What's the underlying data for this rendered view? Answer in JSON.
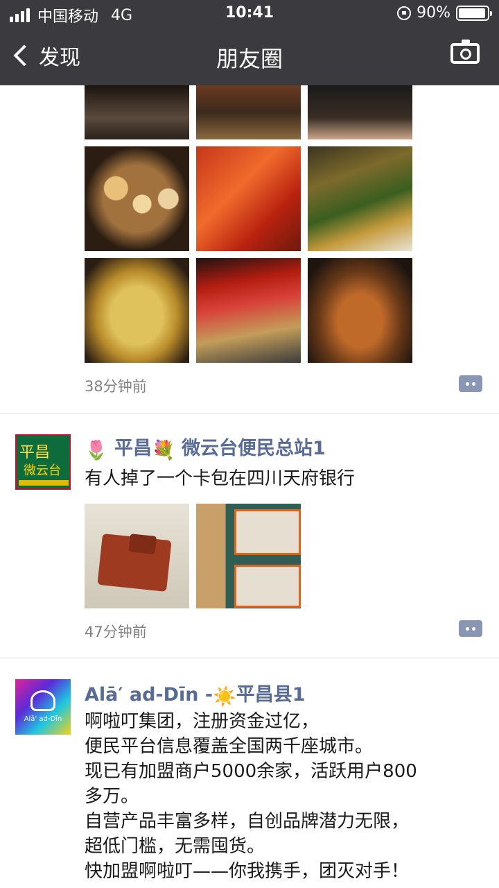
{
  "status_bar": {
    "carrier": "中国移动",
    "network": "4G",
    "time": "10:41",
    "battery": "90%"
  },
  "nav": {
    "back_label": "发现",
    "title": "朋友圈",
    "right_icon": "camera-icon"
  },
  "posts": [
    {
      "images": [
        "restaurant-interior",
        "restaurant-tables",
        "restaurant-floor",
        "seafood-platter",
        "crayfish",
        "grilled-fish-herbs",
        "baked-rice",
        "chili-fish",
        "spicy-dish"
      ],
      "time": "38分钟前"
    },
    {
      "avatar_text": [
        "平昌",
        "微云台"
      ],
      "name_prefix": "平昌",
      "name_suffix": "微云台便民总站1",
      "text": "有人掉了一个卡包在四川天府银行",
      "images": [
        "wallet",
        "cards"
      ],
      "time": "47分钟前"
    },
    {
      "avatar_text": "Alā' ad-Dīn",
      "name_prefix": "Alā′ ad-Dīn -",
      "name_suffix": "平昌县1",
      "lines": [
        "啊啦叮集团，注册资金过亿，",
        "便民平台信息覆盖全国两千座城市。",
        "现已有加盟商户5000余家，活跃用户800",
        "多万。",
        "自营产品丰富多样，自创品牌潜力无限，",
        "超低门槛，无需囤货。",
        "快加盟啊啦叮——你我携手，团灭对手！"
      ]
    }
  ],
  "colors": {
    "nav_bg": "#3a3a3f",
    "name": "#576b95",
    "meta": "#808080"
  }
}
